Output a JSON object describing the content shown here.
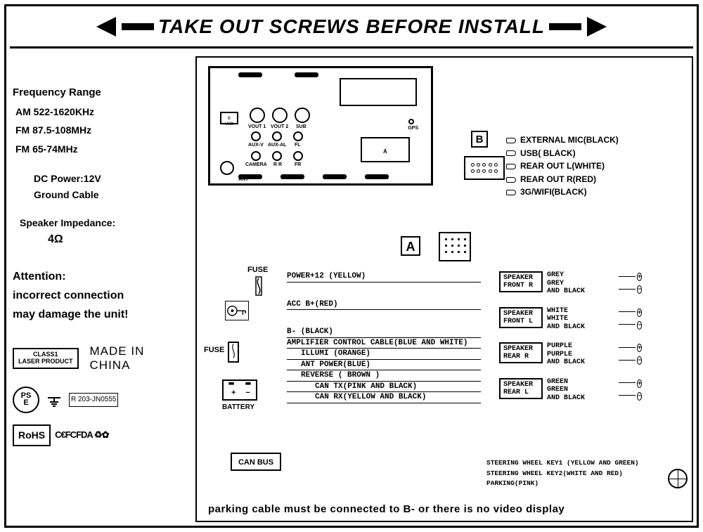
{
  "header": {
    "title": "TAKE OUT SCREWS BEFORE INSTALL"
  },
  "specs": {
    "freq_title": "Frequency Range",
    "am": "AM 522-1620KHz",
    "fm1": "FM 87.5-108MHz",
    "fm2": "FM 65-74MHz",
    "dc": "DC Power:12V",
    "ground": "Ground Cable",
    "si_title": "Speaker Impedance:",
    "si_val": "4Ω"
  },
  "attention": {
    "l1": "Attention:",
    "l2": "incorrect connection",
    "l3": "may damage the unit!"
  },
  "certs": {
    "class1_a": "CLASS1",
    "class1_b": "LASER PRODUCT",
    "made_in_a": "MADE IN",
    "made_in_b": "CHINA",
    "pse_a": "PS",
    "pse_b": "E",
    "jn": "R 203-JN0555",
    "rohs": "RoHS",
    "ce_etc": "C€FCFDA ♻✿"
  },
  "backpanel": {
    "usb": "B\nUSB",
    "vout1": "VOUT 1",
    "vout2": "VOUT 2",
    "sub": "SUB",
    "auxv": "AUX-V",
    "auxal": "AUX-AL",
    "fl": "FL",
    "camera": "CAMERA",
    "rr": "R R",
    "fr": "FR",
    "ant": "ANT",
    "gps": "GPS",
    "a": "A"
  },
  "connB": {
    "label": "B",
    "l1": "EXTERNAL MIC(BLACK)",
    "l2": "USB( BLACK)",
    "l3": "REAR OUT L(WHITE)",
    "l4": "REAR OUT R(RED)",
    "l5": "3G/WIFI(BLACK)"
  },
  "connA": {
    "label": "A"
  },
  "fuse": {
    "label": "FUSE",
    "label2": "FUSE",
    "battery": "BATTERY",
    "canbus": "CAN BUS"
  },
  "wires": {
    "w1": "POWER+12 (YELLOW)",
    "w2": "ACC B+(RED)",
    "w3": "B- (BLACK)",
    "w4": "AMPLIFIER CONTROL CABLE(BLUE AND WHITE)",
    "w5": "ILLUMI (ORANGE)",
    "w6": "ANT POWER(BLUE)",
    "w7": "REVERSE ( BROWN )",
    "w8": "CAN TX(PINK AND BLACK)",
    "w9": "CAN RX(YELLOW AND BLACK)"
  },
  "speakers": [
    {
      "pos_a": "SPEAKER",
      "pos_b": "FRONT  R",
      "c1": "GREY",
      "c2": "GREY",
      "c3": "AND BLACK"
    },
    {
      "pos_a": "SPEAKER",
      "pos_b": "FRONT  L",
      "c1": "WHITE",
      "c2": "WHITE",
      "c3": "AND BLACK"
    },
    {
      "pos_a": "SPEAKER",
      "pos_b": "REAR   R",
      "c1": "PURPLE",
      "c2": "PURPLE",
      "c3": "AND BLACK"
    },
    {
      "pos_a": "SPEAKER",
      "pos_b": "REAR   L",
      "c1": "GREEN",
      "c2": "GREEN",
      "c3": "AND BLACK"
    }
  ],
  "steering": {
    "s1": "STEERING WHEEL KEY1 (YELLOW AND GREEN)",
    "s2": "STEERING  WHEEL KEY2(WHITE AND RED)",
    "s3": "PARKING(PINK)"
  },
  "bottom_note": "parking cable must be connected to B- or there is no video display"
}
